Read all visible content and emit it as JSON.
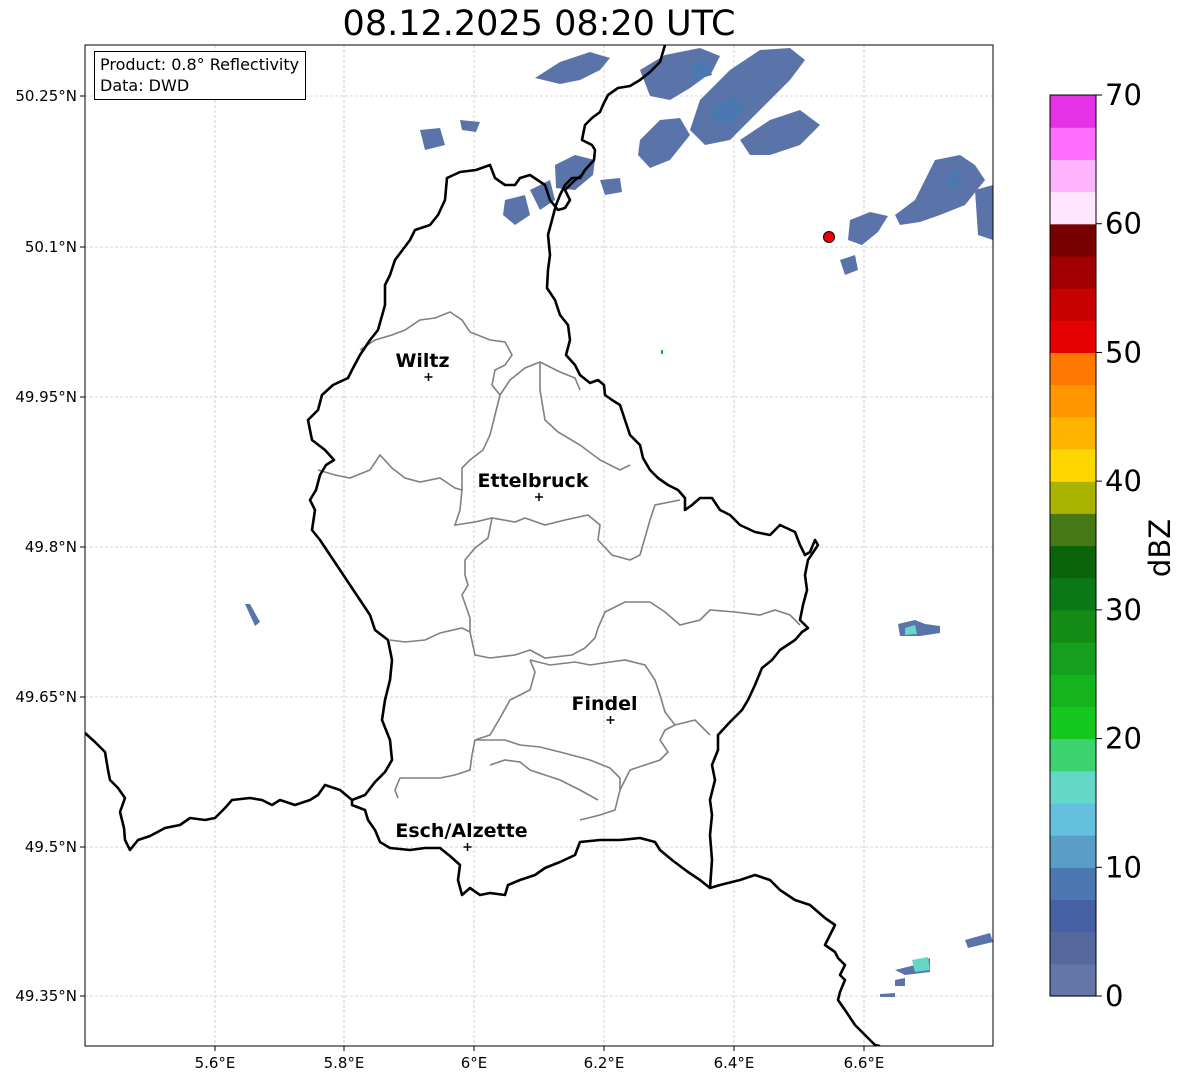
{
  "title": "08.12.2025 08:20 UTC",
  "info": {
    "product": "Product: 0.8° Reflectivity",
    "data": "Data: DWD"
  },
  "axes": {
    "x_ticks": [
      "5.6°E",
      "5.8°E",
      "6°E",
      "6.2°E",
      "6.4°E",
      "6.6°E"
    ],
    "y_ticks": [
      "50.25°N",
      "50.1°N",
      "49.95°N",
      "49.8°N",
      "49.65°N",
      "49.5°N",
      "49.35°N"
    ]
  },
  "cities": [
    {
      "name": "Wiltz",
      "lon": 5.93,
      "lat": 49.97
    },
    {
      "name": "Ettelbruck",
      "lon": 6.1,
      "lat": 49.85
    },
    {
      "name": "Findel",
      "lon": 6.21,
      "lat": 49.627
    },
    {
      "name": "Esch/Alzette",
      "lon": 5.99,
      "lat": 49.5
    }
  ],
  "radar_site": {
    "lon": 6.548,
    "lat": 50.11,
    "color": "#ee0000"
  },
  "colorbar": {
    "label": "dBZ",
    "tick_labels": [
      "0",
      "10",
      "20",
      "30",
      "40",
      "50",
      "60",
      "70"
    ],
    "min": 0,
    "max": 70,
    "step": 2.5,
    "colors": [
      "#6475a8",
      "#55699e",
      "#4660a4",
      "#4b78b0",
      "#5a9ec8",
      "#64c0dc",
      "#64d8c8",
      "#3cd46e",
      "#14c81e",
      "#14b41e",
      "#14a01e",
      "#148c14",
      "#0a7814",
      "#0a640a",
      "#467814",
      "#aab400",
      "#ffd700",
      "#ffb400",
      "#ff9600",
      "#ff7800",
      "#e60000",
      "#c80000",
      "#a00000",
      "#780000",
      "#ffe6ff",
      "#ffb4ff",
      "#ff6eff",
      "#e632e6"
    ]
  },
  "borders": {
    "national_color": "#000000",
    "canton_color": "#808080"
  }
}
